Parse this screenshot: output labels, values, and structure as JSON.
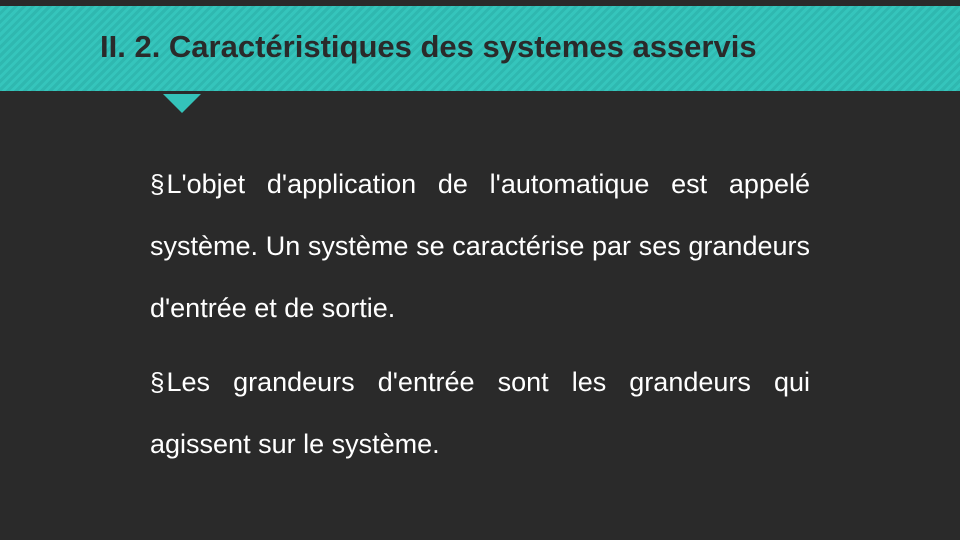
{
  "slide": {
    "heading": "II. 2. Caractéristiques des systemes asservis",
    "bullets": [
      "L'objet d'application de l'automatique est appelé système. Un système se caractérise par ses grandeurs d'entrée et de sortie.",
      "Les grandeurs d'entrée sont les grandeurs qui agissent sur le système."
    ],
    "bullet_glyph": "§"
  }
}
